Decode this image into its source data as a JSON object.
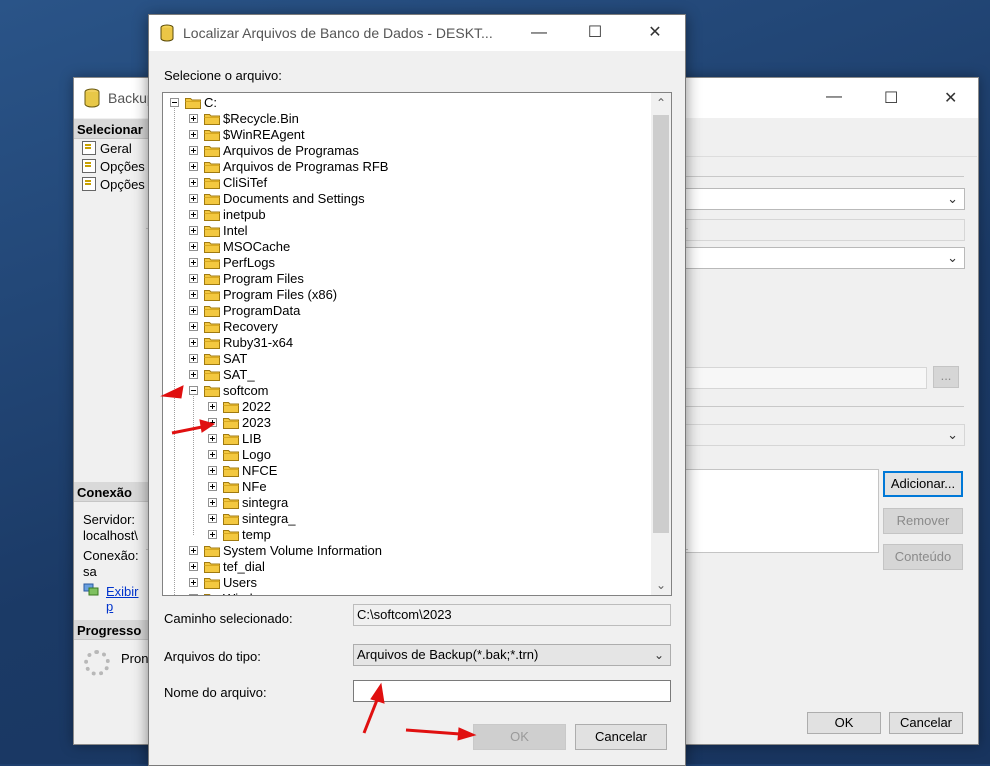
{
  "background_window": {
    "title": "Backup",
    "nav_header": "Selecionar",
    "nav_items": [
      "Geral",
      "Opções",
      "Opções"
    ],
    "connection_header": "Conexão",
    "server_label": "Servidor:",
    "server_value": "localhost\\",
    "connection_label": "Conexão:",
    "connection_value": "sa",
    "link_text": "Exibir p",
    "progress_header": "Progresso",
    "progress_text": "Pron",
    "add_button": "Adicionar...",
    "remove_button": "Remover",
    "contents_button": "Conteúdo",
    "ok_button": "OK",
    "cancel_button": "Cancelar",
    "browse_button": "..."
  },
  "dialog": {
    "title": "Localizar Arquivos de Banco de Dados - DESKT...",
    "select_label": "Selecione o arquivo:",
    "selected_path_label": "Caminho selecionado:",
    "selected_path_value": "C:\\softcom\\2023",
    "file_type_label": "Arquivos do tipo:",
    "file_type_value": "Arquivos de Backup(*.bak;*.trn)",
    "file_name_label": "Nome do arquivo:",
    "file_name_value": "",
    "ok_button": "OK",
    "cancel_button": "Cancelar"
  },
  "tree": {
    "root": "C:",
    "top_items": [
      "$Recycle.Bin",
      "$WinREAgent",
      "Arquivos de Programas",
      "Arquivos de Programas RFB",
      "CliSiTef",
      "Documents and Settings",
      "inetpub",
      "Intel",
      "MSOCache",
      "PerfLogs",
      "Program Files",
      "Program Files (x86)",
      "ProgramData",
      "Recovery",
      "Ruby31-x64",
      "SAT",
      "SAT_"
    ],
    "expanded_item": "softcom",
    "sub_items": [
      "2022",
      "2023",
      "LIB",
      "Logo",
      "NFCE",
      "NFe",
      "sintegra",
      "sintegra_",
      "temp"
    ],
    "selected_sub": "2023",
    "after_items": [
      "System Volume Information",
      "tef_dial",
      "Users",
      "Windows"
    ]
  },
  "colors": {
    "accent": "#0078d7",
    "folder": "#f3c840",
    "annotation_arrow": "#e01010"
  }
}
